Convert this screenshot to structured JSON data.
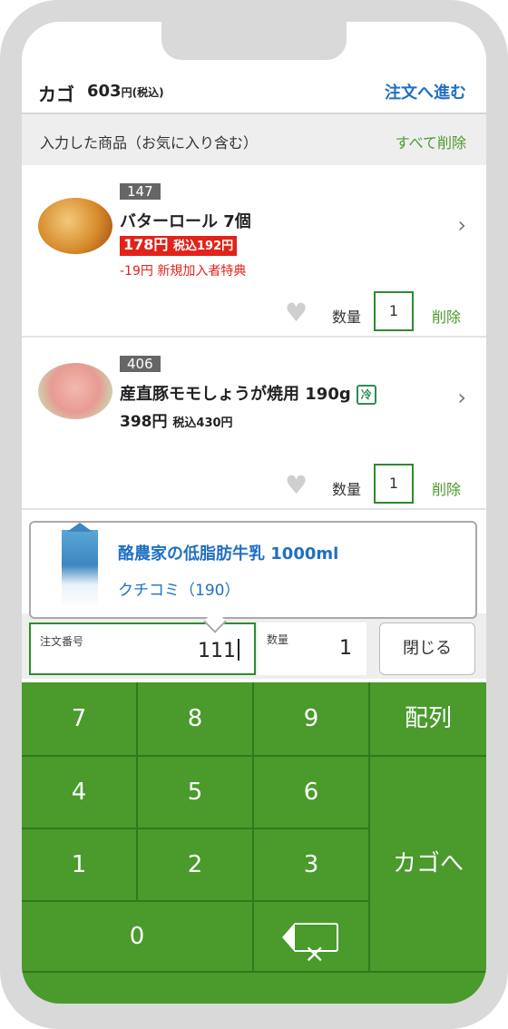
{
  "header": {
    "cart_title": "カゴ",
    "cart_total": "603",
    "cart_total_suffix": "円(税込)",
    "checkout_label": "注文へ進む"
  },
  "section": {
    "label": "入力した商品（お気に入り含む）",
    "delete_all_label": "すべて削除"
  },
  "items": [
    {
      "code": "147",
      "name": "バターロール 7個",
      "price": "178円",
      "price_tax": "税込192円",
      "promo": "-19円 新規加入者特典",
      "quantity_label": "数量",
      "quantity": "1",
      "delete_label": "削除"
    },
    {
      "code": "406",
      "name": "産直豚モモしょうが焼用 190g",
      "badge": "冷",
      "price": "398円",
      "price_tax": "税込430円",
      "quantity_label": "数量",
      "quantity": "1",
      "delete_label": "削除"
    }
  ],
  "popup": {
    "product_name": "酪農家の低脂肪牛乳 1000ml",
    "reviews": "クチコミ（190）"
  },
  "input": {
    "order_label": "注文番号",
    "order_value": "111",
    "qty_label": "数量",
    "qty_value": "1",
    "close_label": "閉じる"
  },
  "keypad": {
    "k7": "7",
    "k8": "8",
    "k9": "9",
    "kArr": "配列",
    "k4": "4",
    "k5": "5",
    "k6": "6",
    "k1": "1",
    "k2": "2",
    "k3": "3",
    "kCart": "カゴへ",
    "k0": "0"
  },
  "colors": {
    "accent_green": "#4a9a2c",
    "link_blue": "#1f6fc4",
    "sale_red": "#e2231a"
  },
  "icons": {
    "chevron": "chevron-right-icon",
    "heart": "heart-icon",
    "backspace": "backspace-icon",
    "cold": "refrigerated-icon"
  }
}
